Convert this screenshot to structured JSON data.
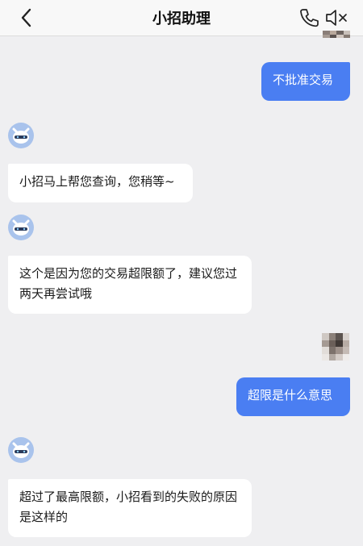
{
  "header": {
    "title": "小招助理"
  },
  "icons": {
    "back": "chevron-left-icon",
    "call": "phone-icon",
    "mute": "speaker-muted-icon"
  },
  "colors": {
    "user_bubble": "#4a7ef2",
    "bot_bubble": "#ffffff",
    "background": "#efeff1"
  },
  "messages": [
    {
      "from": "user",
      "text": "不批准交易"
    },
    {
      "from": "bot",
      "text": "小招马上帮您查询，您稍等~"
    },
    {
      "from": "bot",
      "text": "这个是因为您的交易超限额了，建议您过两天再尝试哦"
    },
    {
      "from": "user",
      "text": "超限是什么意思"
    },
    {
      "from": "bot",
      "text": "超过了最高限额，小招看到的失败的原因是这样的"
    }
  ]
}
